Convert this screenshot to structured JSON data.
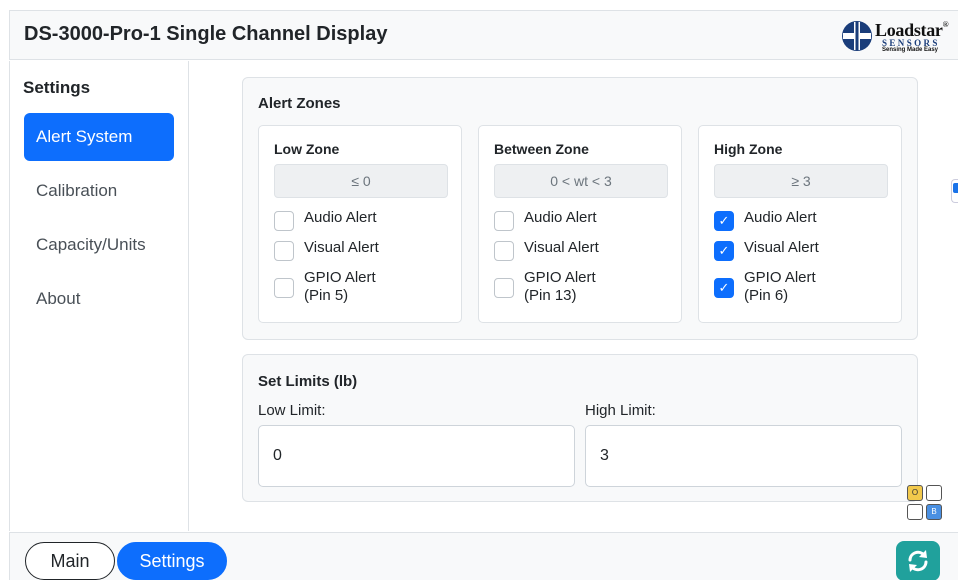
{
  "header": {
    "title": "DS-3000-Pro-1 Single Channel Display",
    "logo": {
      "word": "Loadstar",
      "reg": "®",
      "sub": "SENSORS",
      "tagline": "Sensing Made Easy"
    }
  },
  "sidebar": {
    "title": "Settings",
    "items": [
      {
        "label": "Alert System",
        "active": true
      },
      {
        "label": "Calibration",
        "active": false
      },
      {
        "label": "Capacity/Units",
        "active": false
      },
      {
        "label": "About",
        "active": false
      }
    ]
  },
  "alert_zones": {
    "title": "Alert Zones",
    "zones": [
      {
        "title": "Low Zone",
        "range": "≤ 0",
        "alerts": [
          {
            "label": "Audio Alert",
            "checked": false
          },
          {
            "label": "Visual Alert",
            "checked": false
          },
          {
            "label": "GPIO Alert (Pin 5)",
            "line1": "GPIO Alert",
            "line2": "(Pin 5)",
            "checked": false
          }
        ]
      },
      {
        "title": "Between Zone",
        "range": "0 < wt < 3",
        "alerts": [
          {
            "label": "Audio Alert",
            "checked": false
          },
          {
            "label": "Visual Alert",
            "checked": false
          },
          {
            "label": "GPIO Alert (Pin 13)",
            "line1": "GPIO Alert",
            "line2": "(Pin 13)",
            "checked": false
          }
        ]
      },
      {
        "title": "High Zone",
        "range": "≥ 3",
        "alerts": [
          {
            "label": "Audio Alert",
            "checked": true
          },
          {
            "label": "Visual Alert",
            "checked": true
          },
          {
            "label": "GPIO Alert (Pin 6)",
            "line1": "GPIO Alert",
            "line2": "(Pin 6)",
            "checked": true
          }
        ]
      }
    ]
  },
  "set_limits": {
    "title": "Set Limits (lb)",
    "low_label": "Low Limit:",
    "low_value": "0",
    "high_label": "High Limit:",
    "high_value": "3"
  },
  "footer": {
    "main_label": "Main",
    "settings_label": "Settings",
    "refresh_icon": "refresh-icon"
  },
  "mini_grid": {
    "o_label": "O",
    "b_label": "B"
  },
  "colors": {
    "accent": "#0d6efd",
    "refresh": "#20a19c",
    "mini_o": "#f2c94c",
    "mini_b": "#4a90e2"
  }
}
